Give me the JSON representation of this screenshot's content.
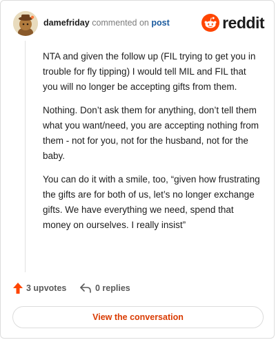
{
  "comment": {
    "username": "damefriday",
    "action_text": "commented on",
    "post_link": "post",
    "paragraphs": [
      "NTA and given the follow up (FIL trying to get you in trouble for fly tipping) I would tell MIL and FIL that you will no longer be accepting gifts from them.",
      "Nothing. Don’t ask them for anything, don’t tell them what you want/need, you are accepting nothing from them - not for you, not for the husband, not for the baby.",
      "You can do it with a smile, too, “given how frustrating the gifts are for both of us, let’s no longer exchange gifts. We have everything we need, spend that money on ourselves. I really insist”"
    ]
  },
  "brand": {
    "name": "reddit",
    "logo_icon": "reddit-logo-icon",
    "accent": "#ff4500"
  },
  "actions": {
    "upvotes_label": "3 upvotes",
    "replies_label": "0 replies",
    "upvote_icon": "upvote-arrow-icon",
    "reply_icon": "reply-arrow-icon",
    "upvote_color": "#ff4500"
  },
  "cta": {
    "label": "View the conversation",
    "color": "#d93a00"
  }
}
